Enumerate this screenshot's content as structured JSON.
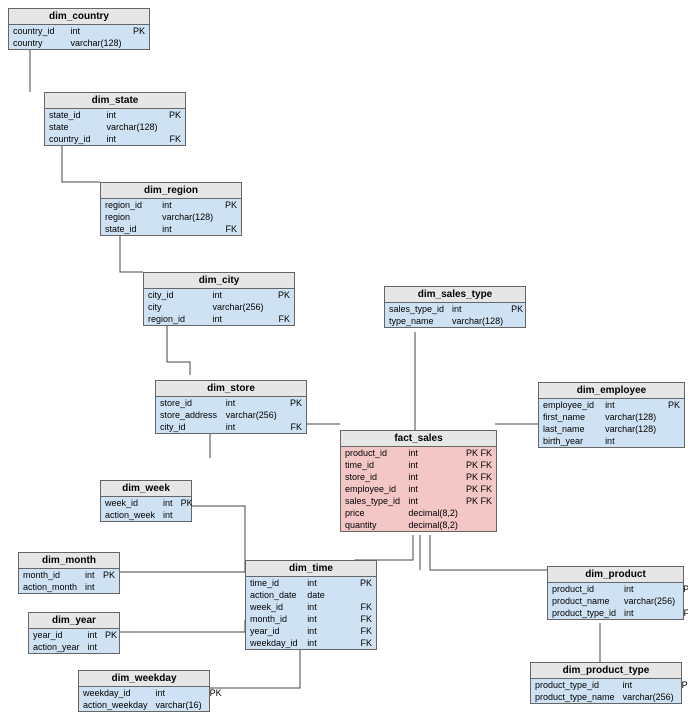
{
  "entities": {
    "dim_country": {
      "name": "dim_country",
      "columns": [
        {
          "name": "country_id",
          "type": "int",
          "key": "PK"
        },
        {
          "name": "country",
          "type": "varchar(128)",
          "key": ""
        }
      ]
    },
    "dim_state": {
      "name": "dim_state",
      "columns": [
        {
          "name": "state_id",
          "type": "int",
          "key": "PK"
        },
        {
          "name": "state",
          "type": "varchar(128)",
          "key": ""
        },
        {
          "name": "country_id",
          "type": "int",
          "key": "FK"
        }
      ]
    },
    "dim_region": {
      "name": "dim_region",
      "columns": [
        {
          "name": "region_id",
          "type": "int",
          "key": "PK"
        },
        {
          "name": "region",
          "type": "varchar(128)",
          "key": ""
        },
        {
          "name": "state_id",
          "type": "int",
          "key": "FK"
        }
      ]
    },
    "dim_city": {
      "name": "dim_city",
      "columns": [
        {
          "name": "city_id",
          "type": "int",
          "key": "PK"
        },
        {
          "name": "city",
          "type": "varchar(256)",
          "key": ""
        },
        {
          "name": "region_id",
          "type": "int",
          "key": "FK"
        }
      ]
    },
    "dim_store": {
      "name": "dim_store",
      "columns": [
        {
          "name": "store_id",
          "type": "int",
          "key": "PK"
        },
        {
          "name": "store_address",
          "type": "varchar(256)",
          "key": ""
        },
        {
          "name": "city_id",
          "type": "int",
          "key": "FK"
        }
      ]
    },
    "dim_sales_type": {
      "name": "dim_sales_type",
      "columns": [
        {
          "name": "sales_type_id",
          "type": "int",
          "key": "PK"
        },
        {
          "name": "type_name",
          "type": "varchar(128)",
          "key": ""
        }
      ]
    },
    "dim_employee": {
      "name": "dim_employee",
      "columns": [
        {
          "name": "employee_id",
          "type": "int",
          "key": "PK"
        },
        {
          "name": "first_name",
          "type": "varchar(128)",
          "key": ""
        },
        {
          "name": "last_name",
          "type": "varchar(128)",
          "key": ""
        },
        {
          "name": "birth_year",
          "type": "int",
          "key": ""
        }
      ]
    },
    "fact_sales": {
      "name": "fact_sales",
      "columns": [
        {
          "name": "product_id",
          "type": "int",
          "key": "PK FK"
        },
        {
          "name": "time_id",
          "type": "int",
          "key": "PK FK"
        },
        {
          "name": "store_id",
          "type": "int",
          "key": "PK FK"
        },
        {
          "name": "employee_id",
          "type": "int",
          "key": "PK FK"
        },
        {
          "name": "sales_type_id",
          "type": "int",
          "key": "PK FK"
        },
        {
          "name": "price",
          "type": "decimal(8,2)",
          "key": ""
        },
        {
          "name": "quantity",
          "type": "decimal(8,2)",
          "key": ""
        }
      ]
    },
    "dim_week": {
      "name": "dim_week",
      "columns": [
        {
          "name": "week_id",
          "type": "int",
          "key": "PK"
        },
        {
          "name": "action_week",
          "type": "int",
          "key": ""
        }
      ]
    },
    "dim_month": {
      "name": "dim_month",
      "columns": [
        {
          "name": "month_id",
          "type": "int",
          "key": "PK"
        },
        {
          "name": "action_month",
          "type": "int",
          "key": ""
        }
      ]
    },
    "dim_year": {
      "name": "dim_year",
      "columns": [
        {
          "name": "year_id",
          "type": "int",
          "key": "PK"
        },
        {
          "name": "action_year",
          "type": "int",
          "key": ""
        }
      ]
    },
    "dim_weekday": {
      "name": "dim_weekday",
      "columns": [
        {
          "name": "weekday_id",
          "type": "int",
          "key": "PK"
        },
        {
          "name": "action_weekday",
          "type": "varchar(16)",
          "key": ""
        }
      ]
    },
    "dim_time": {
      "name": "dim_time",
      "columns": [
        {
          "name": "time_id",
          "type": "int",
          "key": "PK"
        },
        {
          "name": "action_date",
          "type": "date",
          "key": ""
        },
        {
          "name": "week_id",
          "type": "int",
          "key": "FK"
        },
        {
          "name": "month_id",
          "type": "int",
          "key": "FK"
        },
        {
          "name": "year_id",
          "type": "int",
          "key": "FK"
        },
        {
          "name": "weekday_id",
          "type": "int",
          "key": "FK"
        }
      ]
    },
    "dim_product": {
      "name": "dim_product",
      "columns": [
        {
          "name": "product_id",
          "type": "int",
          "key": "PK"
        },
        {
          "name": "product_name",
          "type": "varchar(256)",
          "key": ""
        },
        {
          "name": "product_type_id",
          "type": "int",
          "key": "FK"
        }
      ]
    },
    "dim_product_type": {
      "name": "dim_product_type",
      "columns": [
        {
          "name": "product_type_id",
          "type": "int",
          "key": "PK"
        },
        {
          "name": "product_type_name",
          "type": "varchar(256)",
          "key": ""
        }
      ]
    }
  },
  "relationships": [
    {
      "from": "dim_state.country_id",
      "to": "dim_country.country_id"
    },
    {
      "from": "dim_region.state_id",
      "to": "dim_state.state_id"
    },
    {
      "from": "dim_city.region_id",
      "to": "dim_region.region_id"
    },
    {
      "from": "dim_store.city_id",
      "to": "dim_city.city_id"
    },
    {
      "from": "fact_sales.store_id",
      "to": "dim_store.store_id"
    },
    {
      "from": "fact_sales.sales_type_id",
      "to": "dim_sales_type.sales_type_id"
    },
    {
      "from": "fact_sales.employee_id",
      "to": "dim_employee.employee_id"
    },
    {
      "from": "fact_sales.time_id",
      "to": "dim_time.time_id"
    },
    {
      "from": "fact_sales.product_id",
      "to": "dim_product.product_id"
    },
    {
      "from": "dim_time.week_id",
      "to": "dim_week.week_id"
    },
    {
      "from": "dim_time.month_id",
      "to": "dim_month.month_id"
    },
    {
      "from": "dim_time.year_id",
      "to": "dim_year.year_id"
    },
    {
      "from": "dim_time.weekday_id",
      "to": "dim_weekday.weekday_id"
    },
    {
      "from": "dim_product.product_type_id",
      "to": "dim_product_type.product_type_id"
    }
  ]
}
